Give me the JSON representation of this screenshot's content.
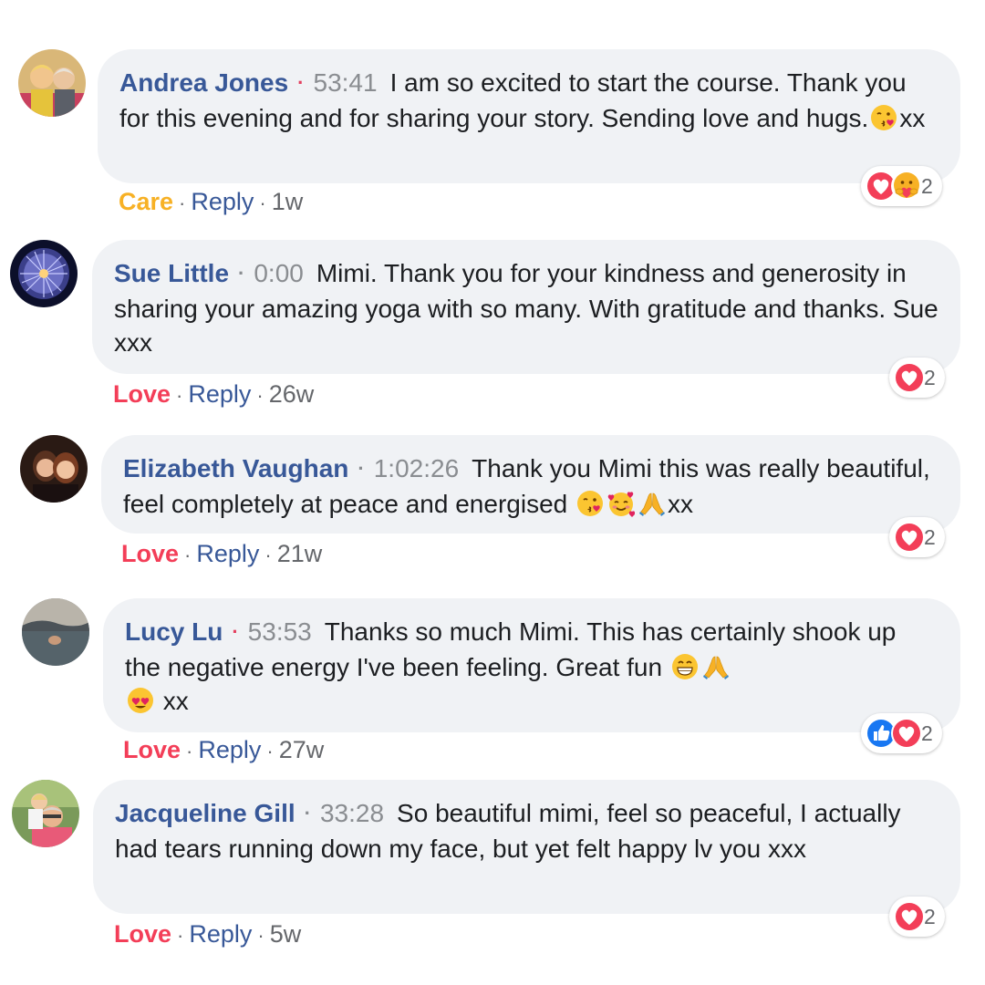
{
  "colors": {
    "link": "#385898",
    "care": "#f7b125",
    "love": "#f33e58",
    "like": "#1877f2",
    "bubble": "#f0f2f5",
    "muted": "#8a8d91"
  },
  "comments": [
    {
      "author": "Andrea Jones",
      "timestamp": "53:41",
      "text": "I am so excited to start the course. Thank you for this evening and for sharing your story. Sending love and hugs.",
      "emoji_suffix": [
        "kissing-heart-emoji"
      ],
      "trailing": "xx",
      "reaction_label": "Care",
      "reply_label": "Reply",
      "age": "1w",
      "reactions": [
        "love-reaction-icon",
        "care-reaction-icon"
      ],
      "reaction_count": "2"
    },
    {
      "author": "Sue Little",
      "timestamp": "0:00",
      "text": "Mimi. Thank you for your kindness and generosity in sharing your amazing yoga with so many. With gratitude and thanks. Sue xxx",
      "reaction_label": "Love",
      "reply_label": "Reply",
      "age": "26w",
      "reactions": [
        "love-reaction-icon"
      ],
      "reaction_count": "2"
    },
    {
      "author": "Elizabeth Vaughan",
      "timestamp": "1:02:26",
      "text": "Thank you Mimi this was really beautiful, feel completely at peace and energised",
      "emoji_suffix": [
        "kissing-heart-emoji",
        "smiling-hearts-emoji",
        "folded-hands-emoji"
      ],
      "trailing": "xx",
      "reaction_label": "Love",
      "reply_label": "Reply",
      "age": "21w",
      "reactions": [
        "love-reaction-icon"
      ],
      "reaction_count": "2"
    },
    {
      "author": "Lucy Lu",
      "timestamp": "53:53",
      "text": "Thanks so much Mimi. This has certainly shook up the negative energy I've been feeling. Great fun",
      "emoji_suffix": [
        "grinning-face-emoji",
        "folded-hands-emoji",
        "heart-eyes-emoji"
      ],
      "trailing": "xx",
      "reaction_label": "Love",
      "reply_label": "Reply",
      "age": "27w",
      "reactions": [
        "like-reaction-icon",
        "love-reaction-icon"
      ],
      "reaction_count": "2"
    },
    {
      "author": "Jacqueline Gill",
      "timestamp": "33:28",
      "text": "So beautiful mimi, feel so peaceful, I actually had tears running down my face, but yet felt happy lv you xxx",
      "reaction_label": "Love",
      "reply_label": "Reply",
      "age": "5w",
      "reactions": [
        "love-reaction-icon"
      ],
      "reaction_count": "2"
    }
  ]
}
